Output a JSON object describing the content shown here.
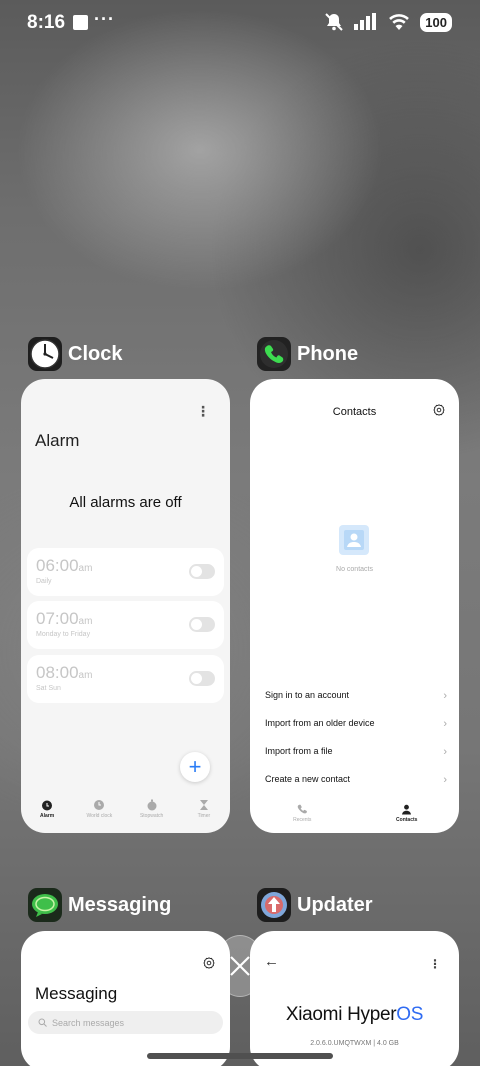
{
  "status_bar": {
    "time": "8:16",
    "overflow": "···",
    "battery": "100"
  },
  "apps": {
    "clock": {
      "name": "Clock",
      "title": "Alarm",
      "empty_message": "All alarms are off",
      "alarms": [
        {
          "hour": "06:00",
          "ampm": "am",
          "repeat": "Daily",
          "enabled": false
        },
        {
          "hour": "07:00",
          "ampm": "am",
          "repeat": "Monday to Friday",
          "enabled": false
        },
        {
          "hour": "08:00",
          "ampm": "am",
          "repeat": "Sat Sun",
          "enabled": false
        }
      ],
      "tabs": [
        "Alarm",
        "World clock",
        "Stopwatch",
        "Timer"
      ]
    },
    "phone": {
      "name": "Phone",
      "title": "Contacts",
      "empty_message": "No contacts",
      "menu": [
        "Sign in to an account",
        "Import from an older device",
        "Import from a file",
        "Create a new contact"
      ],
      "tabs": [
        "Recents",
        "Contacts"
      ]
    },
    "messaging": {
      "name": "Messaging",
      "title": "Messaging",
      "search_placeholder": "Search messages"
    },
    "updater": {
      "name": "Updater",
      "brand_prefix": "Xiaomi Hyper",
      "brand_suffix": "OS",
      "version": "2.0.6.0.UMQTWXM | 4.0 GB"
    }
  },
  "colors": {
    "accent": "#2a7cf5",
    "hyperos_blue": "#2f6bf2"
  }
}
